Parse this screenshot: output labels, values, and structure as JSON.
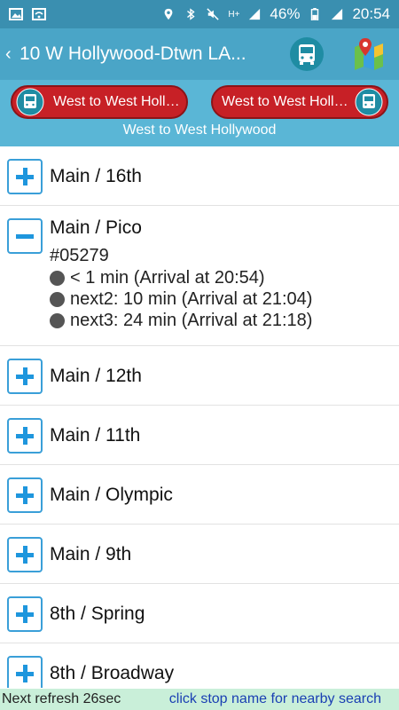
{
  "status_bar": {
    "battery": "46%",
    "time": "20:54",
    "network": "H+"
  },
  "action_bar": {
    "route_title": "10  W Hollywood-Dtwn LA...",
    "back_glyph": "‹"
  },
  "direction": {
    "left_button": "West to West Hollywood",
    "right_button": "West to West Hollywood",
    "current": "West to West Hollywood"
  },
  "stops": [
    {
      "name": "Main / 16th",
      "expanded": false
    },
    {
      "name": "Main / Pico",
      "expanded": true,
      "stop_id": "#05279",
      "arrivals": [
        "< 1 min (Arrival at 20:54)",
        "next2: 10 min (Arrival at 21:04)",
        "next3: 24 min (Arrival at 21:18)"
      ]
    },
    {
      "name": "Main / 12th",
      "expanded": false
    },
    {
      "name": "Main / 11th",
      "expanded": false
    },
    {
      "name": "Main / Olympic",
      "expanded": false
    },
    {
      "name": "Main / 9th",
      "expanded": false
    },
    {
      "name": "8th / Spring",
      "expanded": false
    },
    {
      "name": "8th / Broadway",
      "expanded": false
    }
  ],
  "footer": {
    "refresh": "Next refresh 26sec",
    "hint": "click stop name for nearby search"
  },
  "colors": {
    "statusbar": "#3a8fb0",
    "actionbar": "#4aa5c7",
    "direction_panel": "#5ab6d6",
    "direction_button": "#c72026",
    "toggle_accent": "#1e96dd",
    "footer_bg": "#c9efd9",
    "hint_text": "#1a3fb3"
  },
  "icons": [
    "image-icon",
    "wifi-icon",
    "location-icon",
    "bluetooth-icon",
    "mute-icon",
    "signal-icon",
    "battery-icon",
    "bus-icon",
    "map-icon",
    "plus-icon",
    "minus-icon",
    "dot-icon"
  ]
}
